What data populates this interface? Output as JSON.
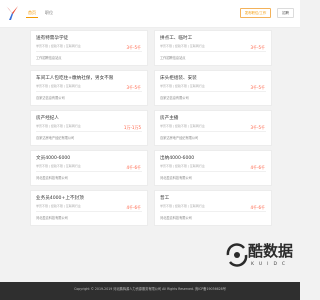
{
  "header": {
    "logo_icon": "y-logo-icon",
    "nav": [
      {
        "label": "首页",
        "active": true
      },
      {
        "label": "职位",
        "active": false
      }
    ],
    "buttons": [
      "发布职位/工作",
      "招聘"
    ]
  },
  "jobs": [
    {
      "title": "送有特需孕学徒",
      "meta": "学历不限 | 经验不限 | 互联网行业",
      "company": "工作招聘信息站点",
      "salary": "3千-5千"
    },
    {
      "title": "拼点工、临时工",
      "meta": "学历不限 | 经验不限 | 互联网行业",
      "company": "工作招聘信息站点",
      "salary": "3千-5千"
    },
    {
      "title": "车间工人包吃住+缴纳社保，男女不限",
      "meta": "学历不限 | 经验不限 | 互联网行业",
      "company": "百家达信息有限公司",
      "salary": "3千-5千"
    },
    {
      "title": "床头柜组装、安装",
      "meta": "学历不限 | 经验不限 | 互联网行业",
      "company": "百家达信息有限公司",
      "salary": "3千-5千"
    },
    {
      "title": "房产经纪人",
      "meta": "学历不限 | 经验不限 | 互联网行业",
      "company": "百家达房地产经纪有限公司",
      "salary": "1万-1万5"
    },
    {
      "title": "房产主播",
      "meta": "学历不限 | 经验不限 | 互联网行业",
      "company": "百家达房地产经纪有限公司",
      "salary": "3千-5千"
    },
    {
      "title": "文员4000-6000",
      "meta": "学历不限 | 经验不限 | 互联网行业",
      "company": "河北盈嘉科技有限公司",
      "salary": "4千-6千"
    },
    {
      "title": "出纳4000-6000",
      "meta": "学历不限 | 经验不限 | 互联网行业",
      "company": "河北盈嘉科技有限公司",
      "salary": "4千-6千"
    },
    {
      "title": "业务员4000+上不封顶",
      "meta": "学历不限 | 经验不限 | 互联网行业",
      "company": "河北盈嘉科技有限公司",
      "salary": "4千-6千"
    },
    {
      "title": "普工",
      "meta": "学历不限 | 经验不限 | 互联网行业",
      "company": "河北盈嘉科技有限公司",
      "salary": "4千-6千"
    }
  ],
  "footer": {
    "text": "Copyright © 2019-2019 河北鹏辉源人力资源服务有限公司 All Rights Reserved. 冀ICP备19036628号"
  },
  "watermark": {
    "text": "酷数据",
    "sub": "KUIDC",
    "icon": "kuidc-logo-icon"
  }
}
